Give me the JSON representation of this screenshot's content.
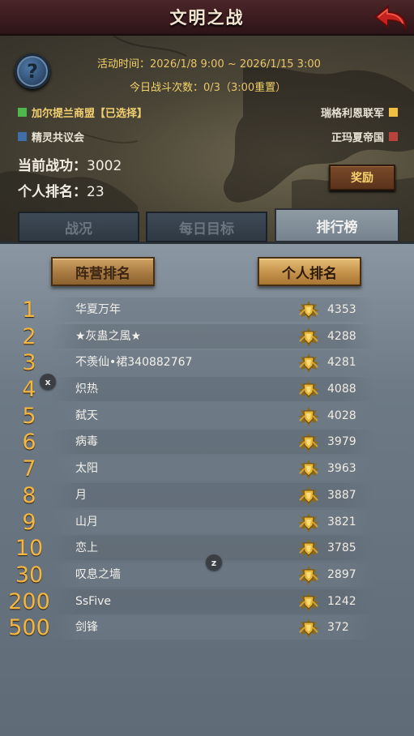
{
  "header": {
    "title": "文明之战"
  },
  "event": {
    "time_label": "活动时间：",
    "time_value": "2026/1/8 9:00 ~ 2026/1/15 3:00",
    "count_label": "今日战斗次数：",
    "count_value": "0/3（3:00",
    "count_reset": "重置",
    "count_close": "）"
  },
  "factions": [
    {
      "name": "加尔提兰商盟【已选择】",
      "color": "#4fb84a"
    },
    {
      "name": "精灵共议会",
      "color": "#3f6ea8"
    },
    {
      "name": "瑞格利恩联军",
      "color": "#f0c040"
    },
    {
      "name": "正玛夏帝国",
      "color": "#b8423c"
    }
  ],
  "stats": {
    "merit_label": "当前战功：",
    "merit_value": "3002",
    "rank_label": "个人排名：",
    "rank_value": "23"
  },
  "reward_button": "奖励",
  "tabs": [
    "战况",
    "每日目标",
    "排行榜"
  ],
  "sub_buttons": {
    "faction": "阵营排名",
    "personal": "个人排名"
  },
  "rankings": [
    {
      "rank": "1",
      "name": "华夏万年",
      "score": "4353"
    },
    {
      "rank": "2",
      "name": "★灰蛊之風★",
      "score": "4288"
    },
    {
      "rank": "3",
      "name": "不羡仙•裙340882767",
      "score": "4281"
    },
    {
      "rank": "4",
      "name": "炽热",
      "score": "4088"
    },
    {
      "rank": "5",
      "name": "弑天",
      "score": "4028"
    },
    {
      "rank": "6",
      "name": "病毒",
      "score": "3979"
    },
    {
      "rank": "7",
      "name": "太阳",
      "score": "3963"
    },
    {
      "rank": "8",
      "name": "月",
      "score": "3887"
    },
    {
      "rank": "9",
      "name": "山月",
      "score": "3821"
    },
    {
      "rank": "10",
      "name": "恋上",
      "score": "3785"
    },
    {
      "rank": "30",
      "name": "叹息之墙",
      "score": "2897"
    },
    {
      "rank": "200",
      "name": "SsFive",
      "score": "1242"
    },
    {
      "rank": "500",
      "name": "剑锋",
      "score": "372"
    }
  ],
  "float_badges": {
    "a": "x",
    "b": "z"
  }
}
